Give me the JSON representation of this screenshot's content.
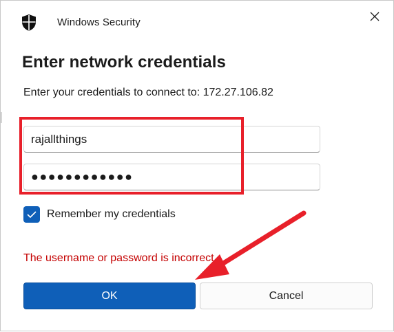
{
  "window": {
    "app_title": "Windows Security",
    "close_icon": "close-icon",
    "shield_icon": "shield-icon"
  },
  "dialog": {
    "heading": "Enter network credentials",
    "subtext": "Enter your credentials to connect to: 172.27.106.82",
    "username_value": "rajallthings",
    "password_display": "●●●●●●●●●●●●",
    "remember_label": "Remember my credentials",
    "remember_checked": true,
    "error_message": "The username or password is incorrect.",
    "ok_label": "OK",
    "cancel_label": "Cancel"
  },
  "annotations": {
    "highlight_color": "#e8202a",
    "arrow_color": "#e8202a"
  },
  "colors": {
    "accent": "#0f5fb8",
    "error": "#c40000"
  }
}
